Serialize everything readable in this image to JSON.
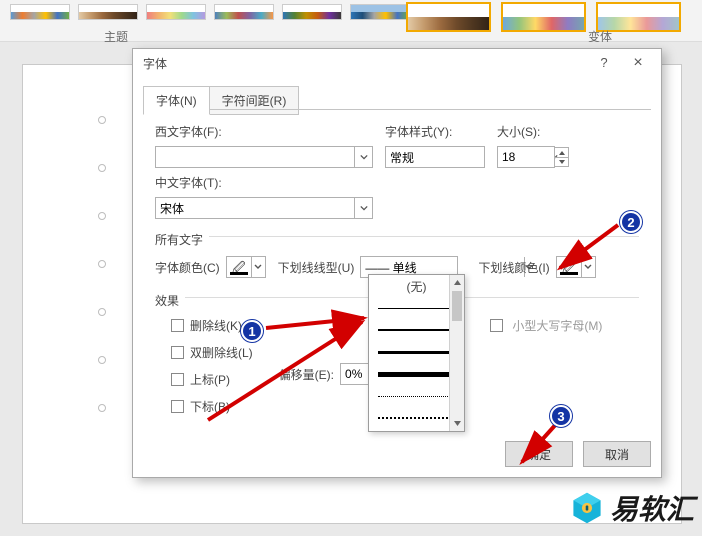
{
  "ribbon": {
    "theme_caption": "主题",
    "variant_caption": "变体"
  },
  "dialog": {
    "title": "字体",
    "help": "?",
    "close": "×",
    "tabs": {
      "font": "字体(N)",
      "spacing": "字符间距(R)"
    },
    "latin_font_label": "西文字体(F):",
    "latin_font_value": "",
    "style_label": "字体样式(Y):",
    "style_value": "常规",
    "size_label": "大小(S):",
    "size_value": "18",
    "asian_font_label": "中文字体(T):",
    "asian_font_value": "宋体",
    "all_text_label": "所有文字",
    "font_color_label": "字体颜色(C)",
    "underline_style_label": "下划线线型(U)",
    "underline_style_value": "—— 单线",
    "underline_color_label": "下划线颜色(I)",
    "underline_options": {
      "none": "(无)"
    },
    "effects_label": "效果",
    "fx": {
      "strike": "删除线(K)",
      "dblstrike": "双删除线(L)",
      "super": "上标(P)",
      "sub": "下标(B)",
      "offset_label": "偏移量(E):",
      "offset_value": "0%",
      "smallcaps": "小型大写字母(M)"
    },
    "buttons": {
      "ok": "确定",
      "cancel": "取消"
    }
  },
  "badges": {
    "b1": "1",
    "b2": "2",
    "b3": "3"
  },
  "watermark": {
    "text": "易软汇"
  }
}
